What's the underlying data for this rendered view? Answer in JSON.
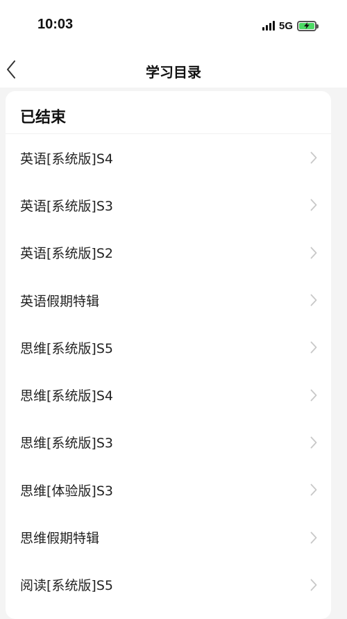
{
  "status_bar": {
    "time": "10:03",
    "network": "5G",
    "signal_icon": "signal-icon",
    "battery_icon": "battery-charging-icon",
    "battery_color": "#4cd964"
  },
  "nav": {
    "title": "学习目录",
    "back_icon": "chevron-left-icon"
  },
  "section": {
    "title": "已结束",
    "items": [
      {
        "label": "英语[系统版]S4"
      },
      {
        "label": "英语[系统版]S3"
      },
      {
        "label": "英语[系统版]S2"
      },
      {
        "label": "英语假期特辑"
      },
      {
        "label": "思维[系统版]S5"
      },
      {
        "label": "思维[系统版]S4"
      },
      {
        "label": "思维[系统版]S3"
      },
      {
        "label": "思维[体验版]S3"
      },
      {
        "label": "思维假期特辑"
      },
      {
        "label": "阅读[系统版]S5"
      }
    ],
    "item_icon": "chevron-right-icon"
  },
  "colors": {
    "background": "#f4f4f4",
    "card": "#ffffff",
    "chevron": "#c8c8c8"
  }
}
